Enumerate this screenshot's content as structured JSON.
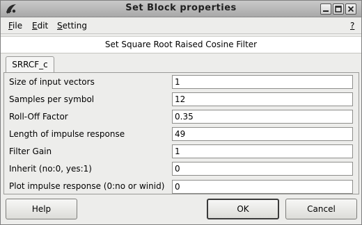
{
  "window": {
    "title": "Set Block properties"
  },
  "menubar": {
    "file": {
      "mnemonic": "F",
      "rest": "ile"
    },
    "edit": {
      "mnemonic": "E",
      "rest": "dit"
    },
    "setting": {
      "mnemonic": "S",
      "rest": "etting"
    },
    "help": "?"
  },
  "header": {
    "title": "Set Square Root Raised Cosine Filter"
  },
  "tabs": [
    {
      "label": "SRRCF_c"
    }
  ],
  "params": [
    {
      "label": "Size of input vectors",
      "value": "1"
    },
    {
      "label": "Samples per symbol",
      "value": "12"
    },
    {
      "label": "Roll-Off Factor",
      "value": "0.35"
    },
    {
      "label": "Length of impulse response",
      "value": "49"
    },
    {
      "label": "Filter Gain",
      "value": "1"
    },
    {
      "label": "Inherit (no:0, yes:1)",
      "value": "0"
    },
    {
      "label": "Plot impulse response (0:no or winid)",
      "value": "0"
    }
  ],
  "buttons": {
    "help": "Help",
    "ok": "OK",
    "cancel": "Cancel"
  },
  "icons": {
    "app": "scilab-icon",
    "minimize": "minimize-icon",
    "maximize": "maximize-icon",
    "close": "close-icon"
  }
}
